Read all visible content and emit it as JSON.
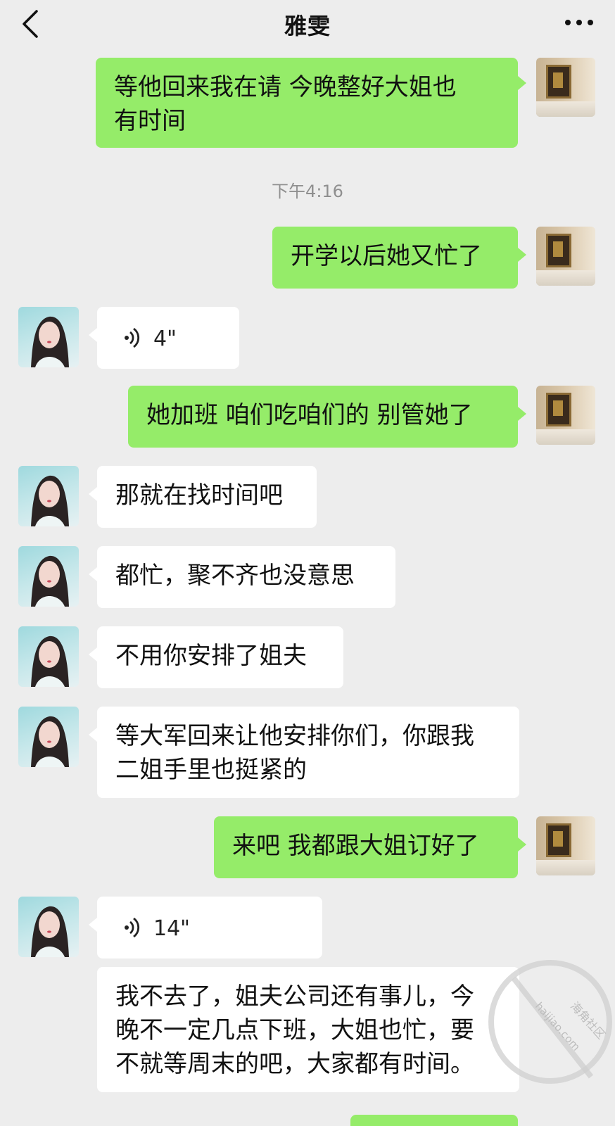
{
  "header": {
    "title": "雅雯",
    "back_icon": "chevron-left-icon",
    "more_icon": "more-icon"
  },
  "timestamp": "下午4:16",
  "messages": [
    {
      "from": "me",
      "type": "text",
      "text": "等他回来我在请 今晚整好大姐也\n有时间"
    },
    {
      "from": "me",
      "type": "text",
      "text": "开学以后她又忙了"
    },
    {
      "from": "them",
      "type": "voice",
      "duration": "4\""
    },
    {
      "from": "me",
      "type": "text",
      "text": "她加班 咱们吃咱们的 别管她了"
    },
    {
      "from": "them",
      "type": "text",
      "text": "那就在找时间吧"
    },
    {
      "from": "them",
      "type": "text",
      "text": "都忙，聚不齐也没意思"
    },
    {
      "from": "them",
      "type": "text",
      "text": "不用你安排了姐夫"
    },
    {
      "from": "them",
      "type": "text",
      "text": "等大军回来让他安排你们，你跟我\n二姐手里也挺紧的"
    },
    {
      "from": "me",
      "type": "text",
      "text": "来吧 我都跟大姐订好了"
    },
    {
      "from": "them",
      "type": "voice",
      "duration": "14\""
    },
    {
      "from": "them",
      "type": "text",
      "text": "我不去了，姐夫公司还有事儿，今\n晚不一定几点下班，大姐也忙，要\n不就等周末的吧，大家都有时间。"
    }
  ],
  "watermark": {
    "text_cn": "海角社区",
    "text_url": "haijiao.com"
  },
  "colors": {
    "my_bubble": "#95ec69",
    "their_bubble": "#ffffff",
    "background": "#ededed"
  }
}
